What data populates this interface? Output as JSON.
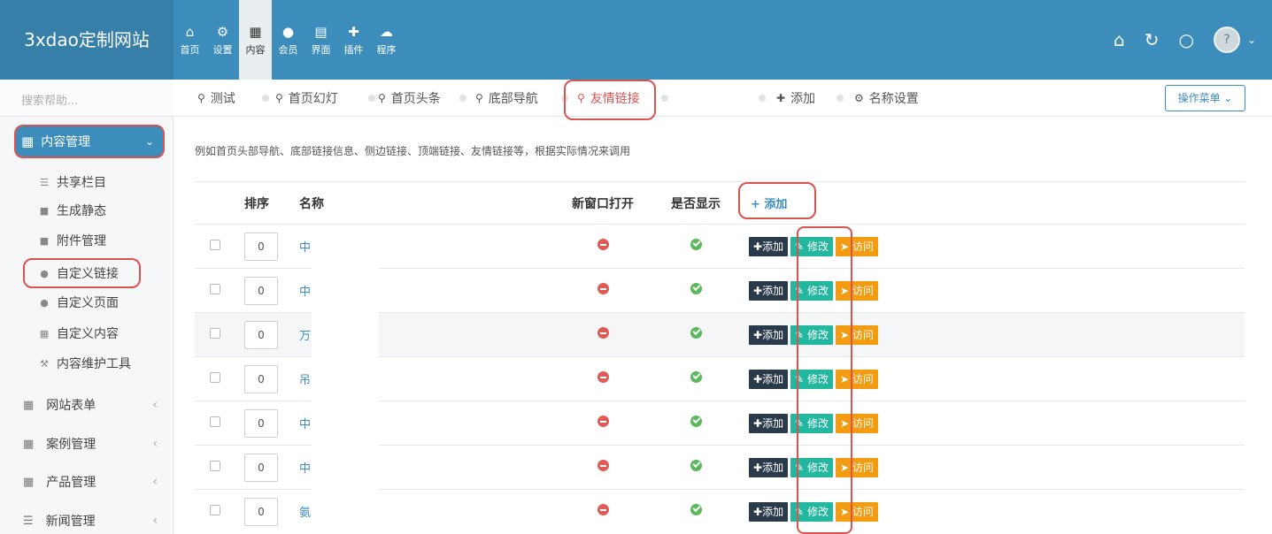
{
  "brand": "3xdao定制网站",
  "topnav": [
    {
      "icon": "home-icon",
      "glyph": "⌂",
      "label": "首页"
    },
    {
      "icon": "gear-icon",
      "glyph": "⚙",
      "label": "设置"
    },
    {
      "icon": "grid-icon",
      "glyph": "▦",
      "label": "内容",
      "active": true
    },
    {
      "icon": "user-icon",
      "glyph": "●",
      "label": "会员"
    },
    {
      "icon": "html5-icon",
      "glyph": "▤",
      "label": "界面"
    },
    {
      "icon": "puzzle-icon",
      "glyph": "✚",
      "label": "插件"
    },
    {
      "icon": "cloud-icon",
      "glyph": "☁",
      "label": "程序"
    }
  ],
  "topright": {
    "home": "⌂",
    "refresh": "↻",
    "power": "○",
    "avatar": "?",
    "caret": "⌄"
  },
  "sidebar": {
    "search_placeholder": "搜索帮助...",
    "section": "内容管理",
    "items": [
      {
        "label": "共享栏目",
        "icon": "list-icon",
        "glyph": "☰"
      },
      {
        "label": "生成静态",
        "icon": "file-icon",
        "glyph": "■"
      },
      {
        "label": "附件管理",
        "icon": "folder-icon",
        "glyph": "■"
      },
      {
        "label": "自定义链接",
        "icon": "map-marker-icon",
        "glyph": "●"
      },
      {
        "label": "自定义页面",
        "icon": "circle-icon",
        "glyph": "●"
      },
      {
        "label": "自定义内容",
        "icon": "grid-icon",
        "glyph": "▦"
      },
      {
        "label": "内容维护工具",
        "icon": "wrench-icon",
        "glyph": "⚒"
      }
    ],
    "groups": [
      {
        "label": "网站表单",
        "icon": "table-icon"
      },
      {
        "label": "案例管理",
        "icon": "table-icon"
      },
      {
        "label": "产品管理",
        "icon": "table-icon"
      },
      {
        "label": "新闻管理",
        "icon": "list-icon"
      }
    ],
    "group_arrow": "‹"
  },
  "tabs": [
    {
      "label": "测试"
    },
    {
      "label": "首页幻灯"
    },
    {
      "label": "首页头条"
    },
    {
      "label": "底部导航"
    },
    {
      "label": "友情链接",
      "active": true
    }
  ],
  "tab_actions": {
    "add": "添加",
    "name_settings": "名称设置"
  },
  "op_menu": "操作菜单 ⌄",
  "description": "例如首页头部导航、底部链接信息、侧边链接、顶端链接、友情链接等，根据实际情况来调用",
  "table": {
    "headers": {
      "order": "排序",
      "name": "名称",
      "new_window": "新窗口打开",
      "show": "是否显示",
      "add": "添加"
    },
    "rows": [
      {
        "order": "0",
        "name": "中"
      },
      {
        "order": "0",
        "name": "中"
      },
      {
        "order": "0",
        "name": "万"
      },
      {
        "order": "0",
        "name": "吊"
      },
      {
        "order": "0",
        "name": "中"
      },
      {
        "order": "0",
        "name": "中"
      },
      {
        "order": "0",
        "name": "氨"
      }
    ],
    "actions": {
      "add": "添加",
      "edit": "修改",
      "visit": "访问"
    }
  },
  "colors": {
    "primary": "#3c8dbc",
    "highlight": "#d9534f",
    "edit": "#23b7a0",
    "visit": "#f39c12",
    "add": "#2b3a4a"
  }
}
